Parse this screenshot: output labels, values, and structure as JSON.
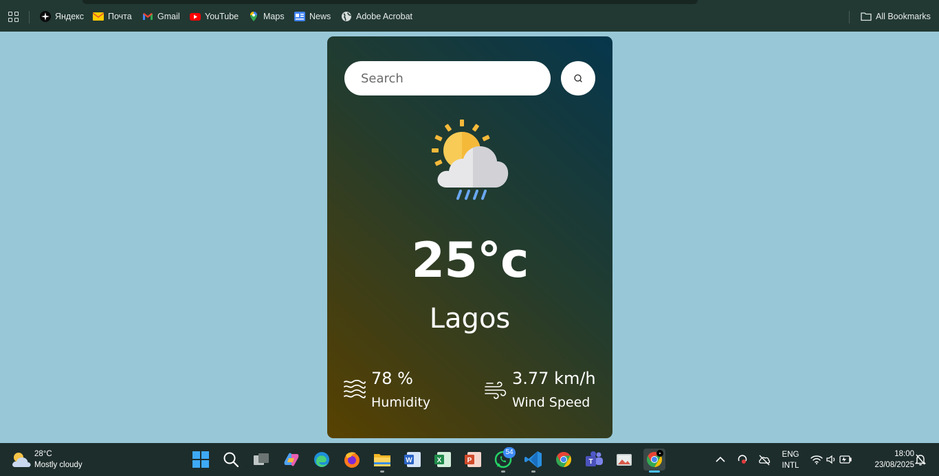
{
  "bookmarks": {
    "items": [
      {
        "label": "Яндекс",
        "icon": "yandex-icon"
      },
      {
        "label": "Почта",
        "icon": "mail-icon"
      },
      {
        "label": "Gmail",
        "icon": "gmail-icon"
      },
      {
        "label": "YouTube",
        "icon": "youtube-icon"
      },
      {
        "label": "Maps",
        "icon": "maps-icon"
      },
      {
        "label": "News",
        "icon": "news-icon"
      },
      {
        "label": "Adobe Acrobat",
        "icon": "globe-icon"
      }
    ],
    "all_bookmarks": "All Bookmarks"
  },
  "weather": {
    "search_placeholder": "Search",
    "temperature": "25°c",
    "city": "Lagos",
    "humidity_value": "78 %",
    "humidity_label": "Humidity",
    "wind_value": "3.77 km/h",
    "wind_label": "Wind Speed",
    "condition_icon": "sun-cloud-rain-icon"
  },
  "taskbar": {
    "weather_temp": "28°C",
    "weather_desc": "Mostly cloudy",
    "apps": [
      "start",
      "search",
      "task-view",
      "copilot",
      "edge",
      "firefox",
      "file-explorer",
      "word",
      "excel",
      "powerpoint",
      "whatsapp",
      "vscode",
      "chrome",
      "teams",
      "photos",
      "chrome-active"
    ],
    "whatsapp_badge": "54",
    "lang_top": "ENG",
    "lang_bottom": "INTL",
    "time": "18:00",
    "date": "23/08/2025"
  }
}
